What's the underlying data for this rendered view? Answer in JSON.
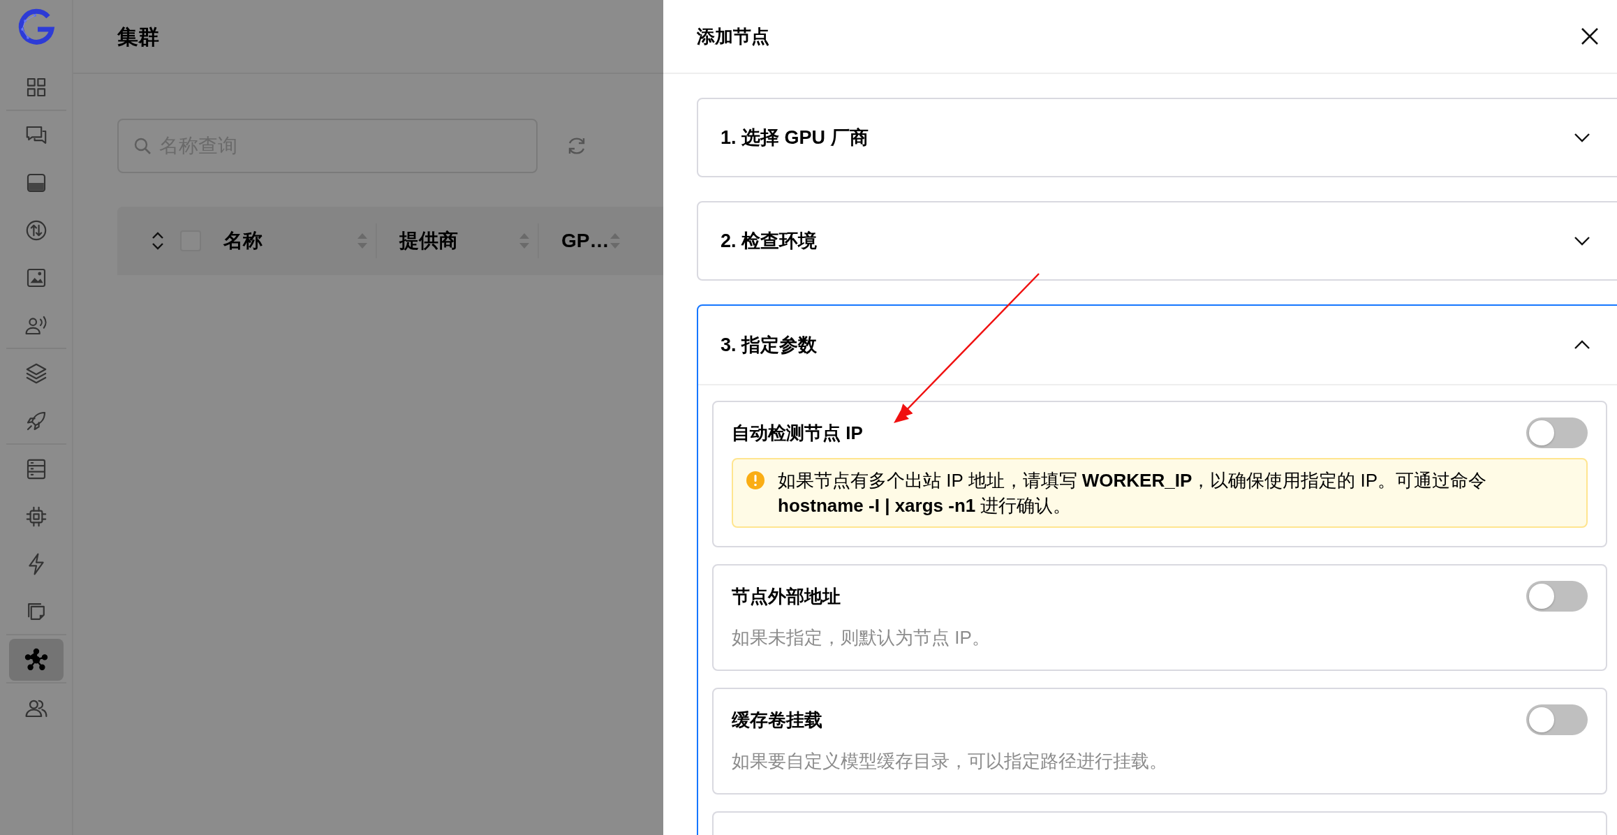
{
  "sidebar": {
    "groups": [
      {
        "items": [
          {
            "selected": false
          }
        ]
      },
      {
        "items": [
          {
            "selected": false
          },
          {
            "selected": false
          },
          {
            "selected": false
          },
          {
            "selected": false
          },
          {
            "selected": false
          }
        ]
      },
      {
        "items": [
          {
            "selected": false
          },
          {
            "selected": false
          }
        ]
      },
      {
        "items": [
          {
            "selected": false
          },
          {
            "selected": false
          },
          {
            "selected": false
          },
          {
            "selected": false
          }
        ]
      },
      {
        "items": [
          {
            "selected": true
          }
        ]
      },
      {
        "items": [
          {
            "selected": false
          }
        ]
      }
    ]
  },
  "page": {
    "title": "集群",
    "search": {
      "placeholder": "名称查询"
    },
    "table": {
      "select_all": {
        "checked": false
      },
      "columns": [
        "名称",
        "提供商",
        "GP…"
      ]
    }
  },
  "drawer": {
    "title": "添加节点",
    "sections": [
      {
        "title": "1. 选择 GPU 厂商",
        "expanded": false
      },
      {
        "title": "2. 检查环境",
        "expanded": false
      },
      {
        "title": "3. 指定参数",
        "expanded": true,
        "settings": [
          {
            "kind": "toggle",
            "title": "自动检测节点 IP",
            "on": false,
            "note": {
              "kind": "warning",
              "text": "如果节点有多个出站 IP 地址，请填写 **WORKER_IP**，以确保使用指定的 IP。可通过命令 **hostname -I | xargs -n1** 进行确认。"
            }
          },
          {
            "kind": "toggle",
            "title": "节点外部地址",
            "on": false,
            "note": {
              "kind": "hint",
              "text": "如果未指定，则默认为节点 IP。"
            }
          },
          {
            "kind": "toggle",
            "title": "缓存卷挂载",
            "on": false,
            "note": {
              "kind": "hint",
              "text": "如果要自定义模型缓存目录，可以指定路径进行挂载。"
            }
          },
          {
            "kind": "cut-off"
          }
        ]
      }
    ]
  }
}
